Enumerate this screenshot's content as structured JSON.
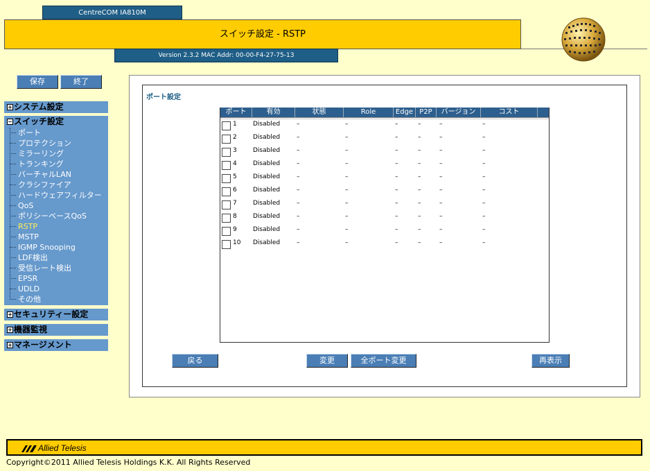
{
  "header": {
    "device_name": "CentreCOM IA810M",
    "page_title": "スイッチ設定 - RSTP",
    "version_info": "Version 2.3.2 MAC Addr: 00-00-F4-27-75-13"
  },
  "top_buttons": {
    "save": "保存",
    "exit": "終了"
  },
  "menu": {
    "system": "システム設定",
    "switch": "スイッチ設定",
    "switch_items": [
      "ポート",
      "プロテクション",
      "ミラーリング",
      "トランキング",
      "バーチャルLAN",
      "クラシファイア",
      "ハードウェアフィルター",
      "QoS",
      "ポリシーベースQoS",
      "RSTP",
      "MSTP",
      "IGMP Snooping",
      "LDF検出",
      "受信レート検出",
      "EPSR",
      "UDLD",
      "その他"
    ],
    "active_item": "RSTP",
    "security": "セキュリティー設定",
    "monitoring": "機器監視",
    "management": "マネージメント"
  },
  "section": {
    "title": "ポート設定"
  },
  "table": {
    "headers": [
      "ポート",
      "有効",
      "状態",
      "Role",
      "Edge",
      "P2P",
      "バージョン",
      "コスト"
    ],
    "rows": [
      {
        "port": "1",
        "enabled": "Disabled",
        "state": "–",
        "role": "–",
        "edge": "–",
        "p2p": "–",
        "version": "–",
        "cost": "–"
      },
      {
        "port": "2",
        "enabled": "Disabled",
        "state": "–",
        "role": "–",
        "edge": "–",
        "p2p": "–",
        "version": "–",
        "cost": "–"
      },
      {
        "port": "3",
        "enabled": "Disabled",
        "state": "–",
        "role": "–",
        "edge": "–",
        "p2p": "–",
        "version": "–",
        "cost": "–"
      },
      {
        "port": "4",
        "enabled": "Disabled",
        "state": "–",
        "role": "–",
        "edge": "–",
        "p2p": "–",
        "version": "–",
        "cost": "–"
      },
      {
        "port": "5",
        "enabled": "Disabled",
        "state": "–",
        "role": "–",
        "edge": "–",
        "p2p": "–",
        "version": "–",
        "cost": "–"
      },
      {
        "port": "6",
        "enabled": "Disabled",
        "state": "–",
        "role": "–",
        "edge": "–",
        "p2p": "–",
        "version": "–",
        "cost": "–"
      },
      {
        "port": "7",
        "enabled": "Disabled",
        "state": "–",
        "role": "–",
        "edge": "–",
        "p2p": "–",
        "version": "–",
        "cost": "–"
      },
      {
        "port": "8",
        "enabled": "Disabled",
        "state": "–",
        "role": "–",
        "edge": "–",
        "p2p": "–",
        "version": "–",
        "cost": "–"
      },
      {
        "port": "9",
        "enabled": "Disabled",
        "state": "–",
        "role": "–",
        "edge": "–",
        "p2p": "–",
        "version": "–",
        "cost": "–"
      },
      {
        "port": "10",
        "enabled": "Disabled",
        "state": "–",
        "role": "–",
        "edge": "–",
        "p2p": "–",
        "version": "–",
        "cost": "–"
      }
    ]
  },
  "actions": {
    "back": "戻る",
    "change": "変更",
    "change_all": "全ポート変更",
    "refresh": "再表示"
  },
  "footer": {
    "logo_text": "Allied Telesis",
    "copyright": "Copyright©2011 Allied Telesis Holdings K.K. All Rights Reserved"
  },
  "colors": {
    "accent_yellow": "#FFCC00",
    "nav_blue": "#6699CC",
    "header_blue": "#1F5E86",
    "background": "#FFFFCC",
    "active_item": "#FFEE55"
  }
}
